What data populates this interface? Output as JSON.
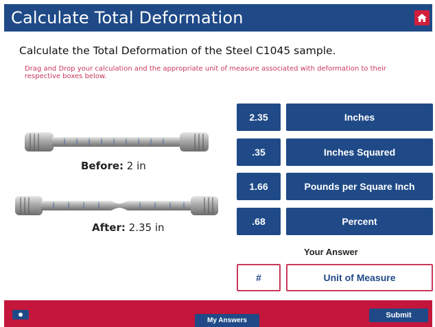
{
  "header": {
    "title": "Calculate Total Deformation",
    "home_icon": "home-icon"
  },
  "prompt": {
    "subtitle": "Calculate the Total Deformation of the Steel C1045 sample.",
    "instructions": "Drag and Drop your calculation and the appropriate unit of measure associated with deformation to their respective boxes below."
  },
  "specimens": {
    "before": {
      "label": "Before:",
      "value": "2 in"
    },
    "after": {
      "label": "After:",
      "value": "2.35 in"
    }
  },
  "choices": {
    "numbers": [
      "2.35",
      ".35",
      "1.66",
      ".68"
    ],
    "units": [
      "Inches",
      "Inches Squared",
      "Pounds per Square Inch",
      "Percent"
    ]
  },
  "answer": {
    "heading": "Your Answer",
    "number_placeholder": "#",
    "unit_placeholder": "Unit of Measure"
  },
  "footer": {
    "my_answers_label": "My Answers",
    "submit_label": "Submit"
  },
  "colors": {
    "primary_blue": "#1f4a87",
    "accent_red": "#c4163b",
    "instruction_pink": "#c8375a"
  }
}
